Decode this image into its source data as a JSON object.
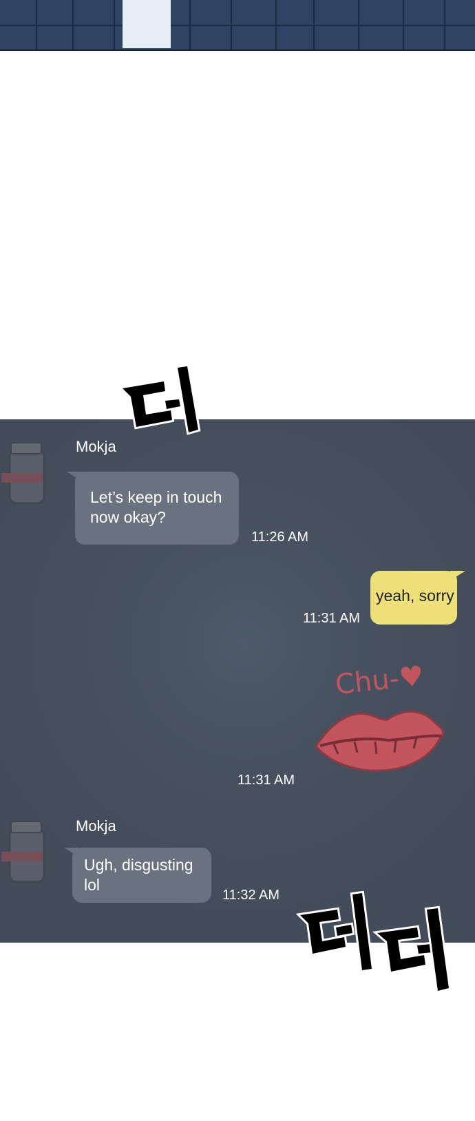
{
  "chat": {
    "messages": [
      {
        "sender": "Mokja",
        "text_lines": [
          "Let’s keep in touch",
          "now okay?"
        ],
        "time": "11:26 AM"
      },
      {
        "text": "yeah, sorry",
        "time": "11:31 AM"
      },
      {
        "sticker_caption": "Chu-♥",
        "sticker_icon": "lips-kiss-sticker",
        "time": "11:31 AM"
      },
      {
        "sender": "Mokja",
        "text_lines": [
          "Ugh, disgusting",
          "lol"
        ],
        "time": "11:32 AM"
      }
    ]
  },
  "colors": {
    "panel": "#434c59",
    "incoming_bubble": "#69727e",
    "outgoing_bubble": "#ede078",
    "sticker_red": "#c2555d",
    "building": "#2e4263"
  }
}
